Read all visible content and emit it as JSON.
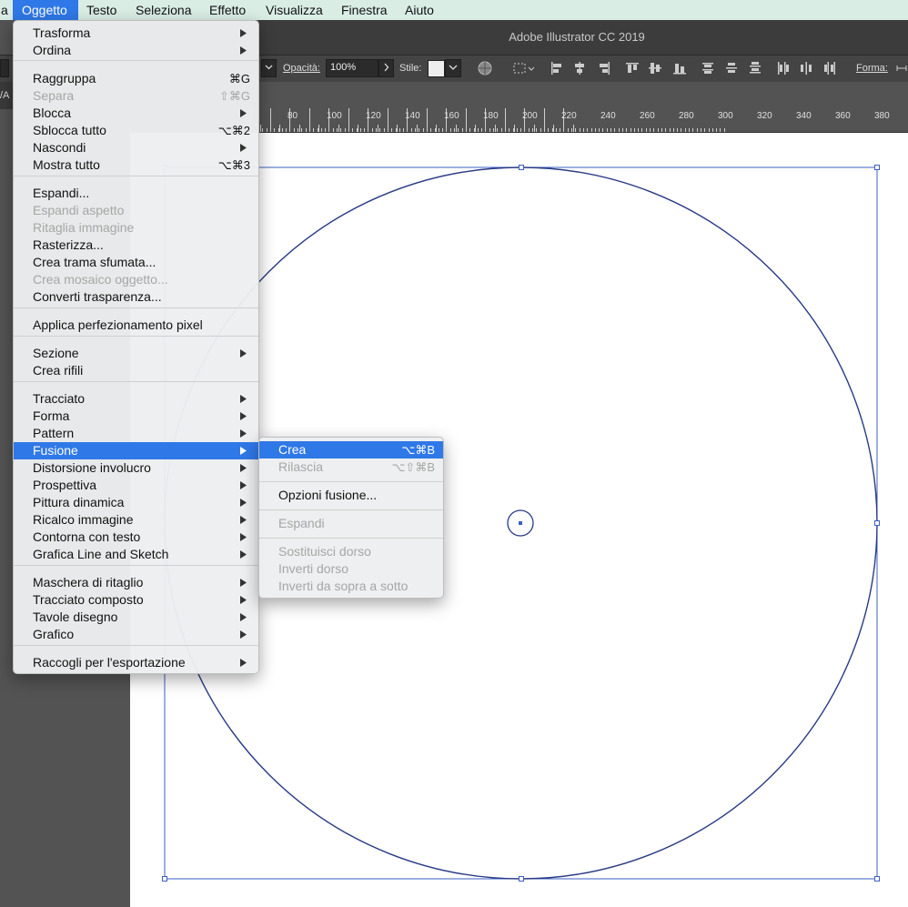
{
  "menubar": {
    "items": [
      {
        "label": "a"
      },
      {
        "label": "Oggetto"
      },
      {
        "label": "Testo"
      },
      {
        "label": "Seleziona"
      },
      {
        "label": "Effetto"
      },
      {
        "label": "Visualizza"
      },
      {
        "label": "Finestra"
      },
      {
        "label": "Aiuto"
      }
    ],
    "active_index": 1
  },
  "window": {
    "title": "Adobe Illustrator CC 2019"
  },
  "controlbar": {
    "opacity_label": "Opacità:",
    "opacity_value": "100%",
    "style_label": "Stile:",
    "shape_label": "Forma:"
  },
  "tab": {
    "label": "/A"
  },
  "ruler": {
    "labels": [
      "80",
      "100",
      "120",
      "140",
      "160",
      "180",
      "200",
      "220",
      "240",
      "260",
      "280",
      "300",
      "320",
      "340",
      "360",
      "380"
    ]
  },
  "main_menu": {
    "items": [
      {
        "label": "Trasforma",
        "submenu": true
      },
      {
        "label": "Ordina",
        "submenu": true
      },
      {
        "label": "Raggruppa",
        "shortcut": "⌘G"
      },
      {
        "label": "Separa",
        "shortcut": "⇧⌘G",
        "disabled": true
      },
      {
        "label": "Blocca",
        "submenu": true
      },
      {
        "label": "Sblocca tutto",
        "shortcut": "⌥⌘2"
      },
      {
        "label": "Nascondi",
        "submenu": true
      },
      {
        "label": "Mostra tutto",
        "shortcut": "⌥⌘3"
      },
      {
        "label": "Espandi..."
      },
      {
        "label": "Espandi aspetto",
        "disabled": true
      },
      {
        "label": "Ritaglia immagine",
        "disabled": true
      },
      {
        "label": "Rasterizza..."
      },
      {
        "label": "Crea trama sfumata..."
      },
      {
        "label": "Crea mosaico oggetto...",
        "disabled": true
      },
      {
        "label": "Converti trasparenza..."
      },
      {
        "label": "Applica perfezionamento pixel"
      },
      {
        "label": "Sezione",
        "submenu": true
      },
      {
        "label": "Crea rifili"
      },
      {
        "label": "Tracciato",
        "submenu": true
      },
      {
        "label": "Forma",
        "submenu": true
      },
      {
        "label": "Pattern",
        "submenu": true
      },
      {
        "label": "Fusione",
        "submenu": true,
        "highlighted": true
      },
      {
        "label": "Distorsione involucro",
        "submenu": true
      },
      {
        "label": "Prospettiva",
        "submenu": true
      },
      {
        "label": "Pittura dinamica",
        "submenu": true
      },
      {
        "label": "Ricalco immagine",
        "submenu": true
      },
      {
        "label": "Contorna con testo",
        "submenu": true
      },
      {
        "label": "Grafica Line and Sketch",
        "submenu": true
      },
      {
        "label": "Maschera di ritaglio",
        "submenu": true
      },
      {
        "label": "Tracciato composto",
        "submenu": true
      },
      {
        "label": "Tavole disegno",
        "submenu": true
      },
      {
        "label": "Grafico",
        "submenu": true
      },
      {
        "label": "Raccogli per l'esportazione",
        "submenu": true
      }
    ]
  },
  "blend_submenu": {
    "items": [
      {
        "label": "Crea",
        "shortcut": "⌥⌘B",
        "highlighted": true
      },
      {
        "label": "Rilascia",
        "shortcut": "⌥⇧⌘B",
        "disabled": true
      },
      {
        "label": "Opzioni fusione..."
      },
      {
        "label": "Espandi",
        "disabled": true
      },
      {
        "label": "Sostituisci dorso",
        "disabled": true
      },
      {
        "label": "Inverti dorso",
        "disabled": true
      },
      {
        "label": "Inverti da sopra a sotto",
        "disabled": true
      }
    ]
  },
  "colors": {
    "selection": "#2f4f9e",
    "highlight": "#2f78e7",
    "menubar_bg": "#d9ede5"
  }
}
